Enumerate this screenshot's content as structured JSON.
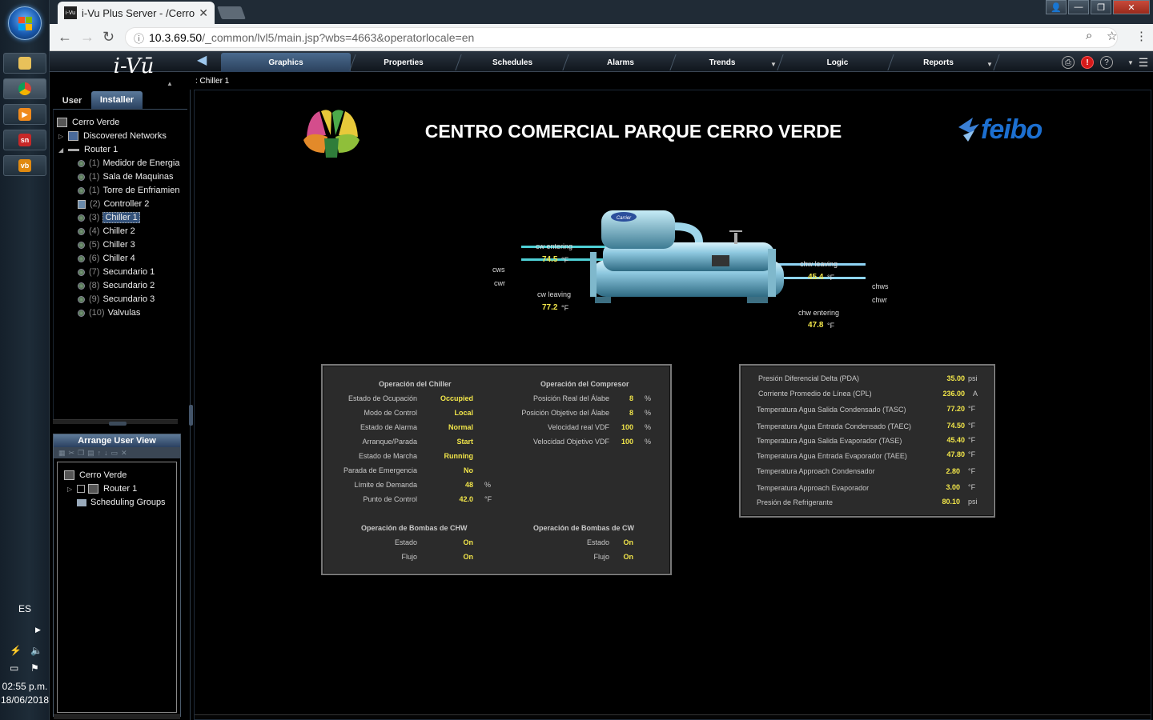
{
  "taskbar": {
    "language": "ES",
    "clock_time": "02:55 p.m.",
    "clock_date": "18/06/2018",
    "apps": [
      {
        "name": "file-explorer",
        "label": ""
      },
      {
        "name": "chrome",
        "label": ""
      },
      {
        "name": "media-player",
        "label": ""
      },
      {
        "name": "sn-app",
        "label": "sn"
      },
      {
        "name": "vb-app",
        "label": "vb"
      }
    ]
  },
  "browser": {
    "tab_title": "i-Vu Plus Server - /Cerro",
    "favicon_text": "i-Vu",
    "url_host": "10.3.69.50",
    "url_path": "/_common/lvl5/main.jsp?wbs=4663&operatorlocale=en"
  },
  "nav": {
    "logo": "i-Vū",
    "tabs": [
      {
        "label": "Graphics",
        "active": true
      },
      {
        "label": "Properties"
      },
      {
        "label": "Schedules"
      },
      {
        "label": "Alarms"
      },
      {
        "label": "Trends"
      },
      {
        "label": "Logic"
      },
      {
        "label": "Reports"
      }
    ],
    "breadcrumb": ": Chiller 1"
  },
  "left_panel": {
    "user_tab": "User",
    "installer_tab": "Installer",
    "tree": {
      "root": "Cerro Verde",
      "discovered": "Discovered Networks",
      "router": "Router 1",
      "devices": [
        {
          "num": "(1)",
          "label": "Medidor de Energia"
        },
        {
          "num": "(1)",
          "label": "Sala de Maquinas"
        },
        {
          "num": "(1)",
          "label": "Torre de Enfriamien"
        },
        {
          "num": "(2)",
          "label": "Controller 2"
        },
        {
          "num": "(3)",
          "label": "Chiller 1",
          "selected": true
        },
        {
          "num": "(4)",
          "label": "Chiller 2"
        },
        {
          "num": "(5)",
          "label": "Chiller 3"
        },
        {
          "num": "(6)",
          "label": "Chiller 4"
        },
        {
          "num": "(7)",
          "label": "Secundario 1"
        },
        {
          "num": "(8)",
          "label": "Secundario 2"
        },
        {
          "num": "(9)",
          "label": "Secundario 3"
        },
        {
          "num": "(10)",
          "label": "Valvulas"
        }
      ]
    },
    "arrange": {
      "title": "Arrange User View",
      "root": "Cerro Verde",
      "router": "Router 1",
      "groups": "Scheduling Groups"
    }
  },
  "main": {
    "title": "CENTRO COMERCIAL PARQUE CERRO VERDE",
    "brand": "feibo",
    "diagram": {
      "cw_entering_label": "cw entering",
      "cw_entering_value": "74.5",
      "cw_leaving_label": "cw leaving",
      "cw_leaving_value": "77.2",
      "chw_leaving_label": "chw leaving",
      "chw_leaving_value": "45.4",
      "chw_entering_label": "chw entering",
      "chw_entering_value": "47.8",
      "unit_f": "°F",
      "cws": "cws",
      "cwr": "cwr",
      "chws": "chws",
      "chwr": "chwr",
      "badge": "Carrier"
    },
    "chiller_panel": {
      "head_chiller": "Operación del Chiller",
      "head_compresor": "Operación del Compresor",
      "head_chw": "Operación de Bombas de CHW",
      "head_cw": "Operación de Bombas de CW",
      "chiller_rows": [
        {
          "label": "Estado de Ocupación",
          "value": "Occupied",
          "unit": ""
        },
        {
          "label": "Modo de Control",
          "value": "Local",
          "unit": ""
        },
        {
          "label": "Estado de Alarma",
          "value": "Normal",
          "unit": ""
        },
        {
          "label": "Arranque/Parada",
          "value": "Start",
          "unit": ""
        },
        {
          "label": "Estado de Marcha",
          "value": "Running",
          "unit": ""
        },
        {
          "label": "Parada de Emergencia",
          "value": "No",
          "unit": ""
        },
        {
          "label": "Límite de Demanda",
          "value": "48",
          "unit": "%"
        },
        {
          "label": "Punto de Control",
          "value": "42.0",
          "unit": "°F"
        }
      ],
      "compresor_rows": [
        {
          "label": "Posición Real del Álabe",
          "value": "8",
          "unit": "%"
        },
        {
          "label": "Posición Objetivo del Álabe",
          "value": "8",
          "unit": "%"
        },
        {
          "label": "Velocidad real VDF",
          "value": "100",
          "unit": "%"
        },
        {
          "label": "Velocidad Objetivo VDF",
          "value": "100",
          "unit": "%"
        }
      ],
      "chw_rows": [
        {
          "label": "Estado",
          "value": "On"
        },
        {
          "label": "Flujo",
          "value": "On"
        }
      ],
      "cw_rows": [
        {
          "label": "Estado",
          "value": "On"
        },
        {
          "label": "Flujo",
          "value": "On"
        }
      ]
    },
    "measures_panel": {
      "rows": [
        {
          "label": "Presión Diferencial Delta  (PDA)",
          "value": "35.00",
          "unit": "psi"
        },
        {
          "label": "Corriente Promedio de Línea (CPL)",
          "value": "236.00",
          "unit": "A"
        },
        {
          "label": "Temperatura Agua Salida Condensado (TASC)",
          "value": "77.20",
          "unit": "°F"
        },
        {
          "label": "Temperatura Agua Entrada Condensado (TAEC)",
          "value": "74.50",
          "unit": "°F"
        },
        {
          "label": "Temperatura Agua Salida Evaporador (TASE)",
          "value": "45.40",
          "unit": "°F"
        },
        {
          "label": "Temperatura Agua Entrada Evaporador (TAEE)",
          "value": "47.80",
          "unit": "°F"
        },
        {
          "label": "Temperatura Approach Condensador",
          "value": "2.80",
          "unit": "°F"
        },
        {
          "label": "Temperatura Approach Evaporador",
          "value": "3.00",
          "unit": "°F"
        },
        {
          "label": "Presión de Refrigerante",
          "value": "80.10",
          "unit": "psi"
        }
      ]
    }
  }
}
